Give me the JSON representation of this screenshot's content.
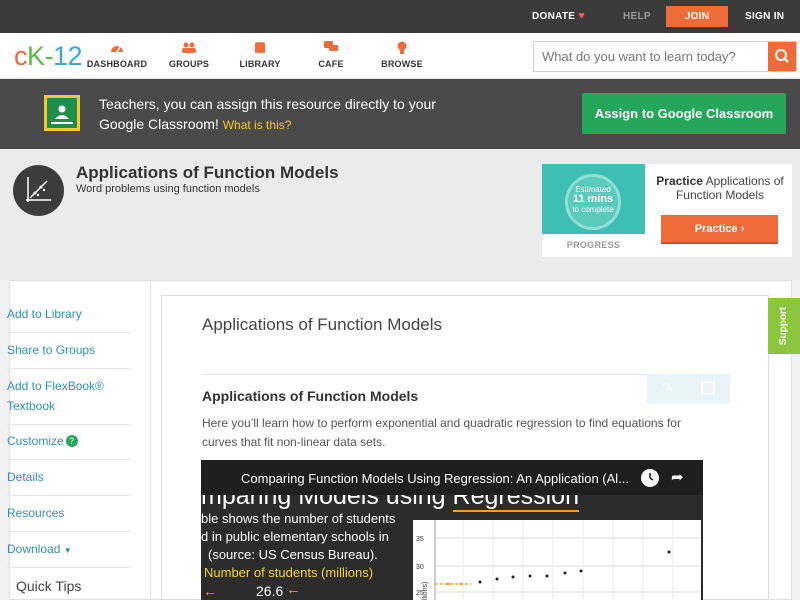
{
  "topbar": {
    "donate": "DONATE",
    "help": "HELP",
    "join": "JOIN",
    "signin": "SIGN IN"
  },
  "nav": {
    "logo": {
      "c": "c",
      "k": "K-",
      "n": "12"
    },
    "items": [
      {
        "label": "DASHBOARD",
        "icon": "dashboard-icon"
      },
      {
        "label": "GROUPS",
        "icon": "groups-icon"
      },
      {
        "label": "LIBRARY",
        "icon": "library-icon"
      },
      {
        "label": "CAFE",
        "icon": "cafe-icon"
      },
      {
        "label": "BROWSE",
        "icon": "browse-icon"
      }
    ],
    "search_placeholder": "What do you want to learn today?"
  },
  "banner": {
    "text": "Teachers, you can assign this resource directly to your Google Classroom!",
    "link": "What is this?",
    "button": "Assign to Google Classroom"
  },
  "header": {
    "title": "Applications of Function Models",
    "subtitle": "Word problems using function models"
  },
  "practice": {
    "estimated": "Estimated",
    "mins": "11 mins",
    "complete": "to complete",
    "progress_label": "PROGRESS",
    "title_bold": "Practice",
    "title_rest": " Applications of Function Models",
    "button": "Practice"
  },
  "sidebar": {
    "items": [
      "Add to Library",
      "Share to Groups",
      "Add to FlexBook®",
      "Textbook",
      "Customize",
      "Details",
      "Resources",
      "Download"
    ],
    "quick_tips": "Quick Tips"
  },
  "main": {
    "title": "Applications of Function Models",
    "section_title": "Applications of Function Models",
    "section_desc": "Here you’ll learn how to perform exponential and quadratic regression to find equations for curves that fit non-linear data sets."
  },
  "video": {
    "title": "Comparing Function Models Using Regression: An Application (Al...",
    "heading_a": "mparing Models using ",
    "heading_b": "Regression",
    "line1": "ble shows the number of students",
    "line2": "d in public elementary schools in",
    "line3": "(source: US Census Bureau).",
    "line4": "Number of students (millions)",
    "value": "26.6",
    "ticks": [
      "35",
      "30",
      "25"
    ],
    "axis_label": "llions)"
  },
  "support": "Support",
  "colors": {
    "accent": "#ef6c3a",
    "green": "#26a65b",
    "link": "#2f8fb3",
    "support": "#8cc63f"
  }
}
